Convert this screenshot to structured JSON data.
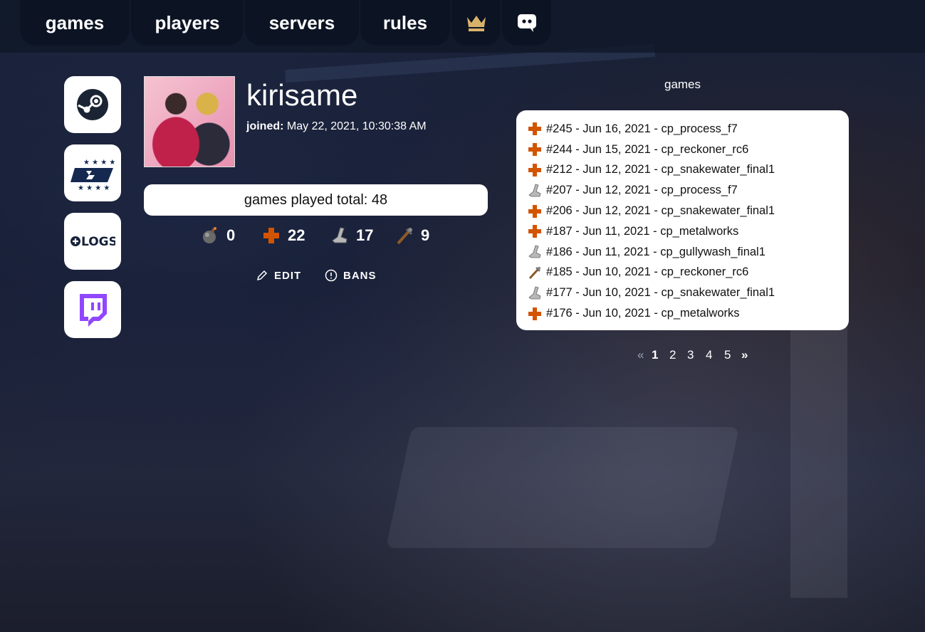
{
  "nav": {
    "tabs": [
      {
        "label": "games"
      },
      {
        "label": "players"
      },
      {
        "label": "servers"
      },
      {
        "label": "rules"
      }
    ],
    "icons": [
      "crown-icon",
      "discord-icon"
    ],
    "crown_color": "#d9b26a"
  },
  "social": [
    "steam-icon",
    "etf2l-icon",
    "logs-icon",
    "twitch-icon"
  ],
  "profile": {
    "username": "kirisame",
    "joined_label": "joined:",
    "joined_value": "May 22, 2021, 10:30:38 AM",
    "games_total": "games played total: 48",
    "stats": [
      {
        "icon": "demoman-icon",
        "value": "0"
      },
      {
        "icon": "medic-icon",
        "value": "22"
      },
      {
        "icon": "scout-icon",
        "value": "17"
      },
      {
        "icon": "sniper-icon",
        "value": "9"
      }
    ],
    "edit_label": "EDIT",
    "bans_label": "BANS"
  },
  "games": {
    "title": "games",
    "rows": [
      {
        "icon": "medic-icon",
        "text": "#245 - Jun 16, 2021 - cp_process_f7"
      },
      {
        "icon": "medic-icon",
        "text": "#244 - Jun 15, 2021 - cp_reckoner_rc6"
      },
      {
        "icon": "medic-icon",
        "text": "#212 - Jun 12, 2021 - cp_snakewater_final1"
      },
      {
        "icon": "scout-icon",
        "text": "#207 - Jun 12, 2021 - cp_process_f7"
      },
      {
        "icon": "medic-icon",
        "text": "#206 - Jun 12, 2021 - cp_snakewater_final1"
      },
      {
        "icon": "medic-icon",
        "text": "#187 - Jun 11, 2021 - cp_metalworks"
      },
      {
        "icon": "scout-icon",
        "text": "#186 - Jun 11, 2021 - cp_gullywash_final1"
      },
      {
        "icon": "sniper-icon",
        "text": "#185 - Jun 10, 2021 - cp_reckoner_rc6"
      },
      {
        "icon": "scout-icon",
        "text": "#177 - Jun 10, 2021 - cp_snakewater_final1"
      },
      {
        "icon": "medic-icon",
        "text": "#176 - Jun 10, 2021 - cp_metalworks"
      }
    ],
    "pager": {
      "prev": "«",
      "pages": [
        "1",
        "2",
        "3",
        "4",
        "5"
      ],
      "current": "1",
      "next": "»"
    }
  },
  "colors": {
    "medic": "#d35400",
    "card_bg": "#ffffff",
    "nav_tab": "#0c1424"
  }
}
